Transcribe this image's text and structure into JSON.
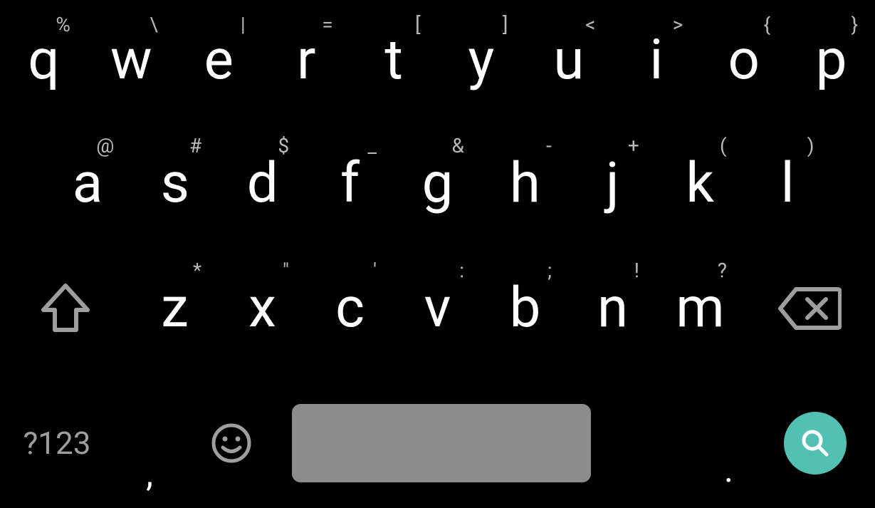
{
  "row1": [
    {
      "main": "q",
      "hint": "%"
    },
    {
      "main": "w",
      "hint": "\\"
    },
    {
      "main": "e",
      "hint": "|"
    },
    {
      "main": "r",
      "hint": "="
    },
    {
      "main": "t",
      "hint": "["
    },
    {
      "main": "y",
      "hint": "]"
    },
    {
      "main": "u",
      "hint": "<"
    },
    {
      "main": "i",
      "hint": ">"
    },
    {
      "main": "o",
      "hint": "{"
    },
    {
      "main": "p",
      "hint": "}"
    }
  ],
  "row2": [
    {
      "main": "a",
      "hint": "@"
    },
    {
      "main": "s",
      "hint": "#"
    },
    {
      "main": "d",
      "hint": "$"
    },
    {
      "main": "f",
      "hint": "_"
    },
    {
      "main": "g",
      "hint": "&"
    },
    {
      "main": "h",
      "hint": "-"
    },
    {
      "main": "j",
      "hint": "+"
    },
    {
      "main": "k",
      "hint": "("
    },
    {
      "main": "l",
      "hint": ")"
    }
  ],
  "row3": [
    {
      "main": "z",
      "hint": "*"
    },
    {
      "main": "x",
      "hint": "\""
    },
    {
      "main": "c",
      "hint": "'"
    },
    {
      "main": "v",
      "hint": ":"
    },
    {
      "main": "b",
      "hint": ";"
    },
    {
      "main": "n",
      "hint": "!"
    },
    {
      "main": "m",
      "hint": "?"
    }
  ],
  "bottom": {
    "symbols_label": "?123",
    "comma_label": ",",
    "period_label": "."
  }
}
